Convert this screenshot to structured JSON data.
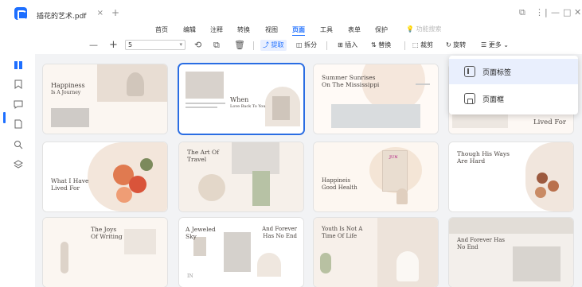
{
  "titlebar": {
    "tab_title": "插花的艺术.pdf",
    "tab_close": "×",
    "tab_add": "+",
    "controls": [
      "⧉",
      "⋮",
      "|",
      "—",
      "□",
      "✕"
    ]
  },
  "menu": {
    "items": [
      "首页",
      "编辑",
      "注释",
      "转换",
      "视图",
      "页面",
      "工具",
      "表单",
      "保护"
    ],
    "active": "页面",
    "feature_search": "功能搜索"
  },
  "toolbar": {
    "zoom_out": "—",
    "zoom_in": "+",
    "page_number": "5",
    "extract": "提取",
    "split": "拆分",
    "insert": "插入",
    "replace": "替换",
    "crop": "裁剪",
    "rotate": "旋转",
    "more": "更多"
  },
  "dropdown": {
    "items": [
      {
        "icon": "page-label-icon",
        "label": "页面标签"
      },
      {
        "icon": "page-frame-icon",
        "label": "页面框"
      }
    ]
  },
  "pages": [
    {
      "title": "Happiness",
      "subtitle": "Is A Journey"
    },
    {
      "title": "When",
      "subtitle": "Love Back To You"
    },
    {
      "title": "Summer Sunrises On The Mississippi"
    },
    {
      "title": "Lived For"
    },
    {
      "title": "What I Have Lived For"
    },
    {
      "title": "The Art Of Travel"
    },
    {
      "title": "Happineis Good Health",
      "tag": "JUN"
    },
    {
      "title": "Though His Ways Are Hard"
    },
    {
      "title": "The Joys Of Writing"
    },
    {
      "title": "A Jeweled Sky",
      "extra": "IN"
    },
    {
      "title": "And Forever Has No End"
    },
    {
      "title": "Youth Is Not A Time Of Life"
    },
    {
      "title": "And Forever Has No End"
    }
  ],
  "colors": {
    "accent": "#1e6fff",
    "selected_border": "#2a6de3",
    "grid_bg": "#f2f3f5"
  }
}
